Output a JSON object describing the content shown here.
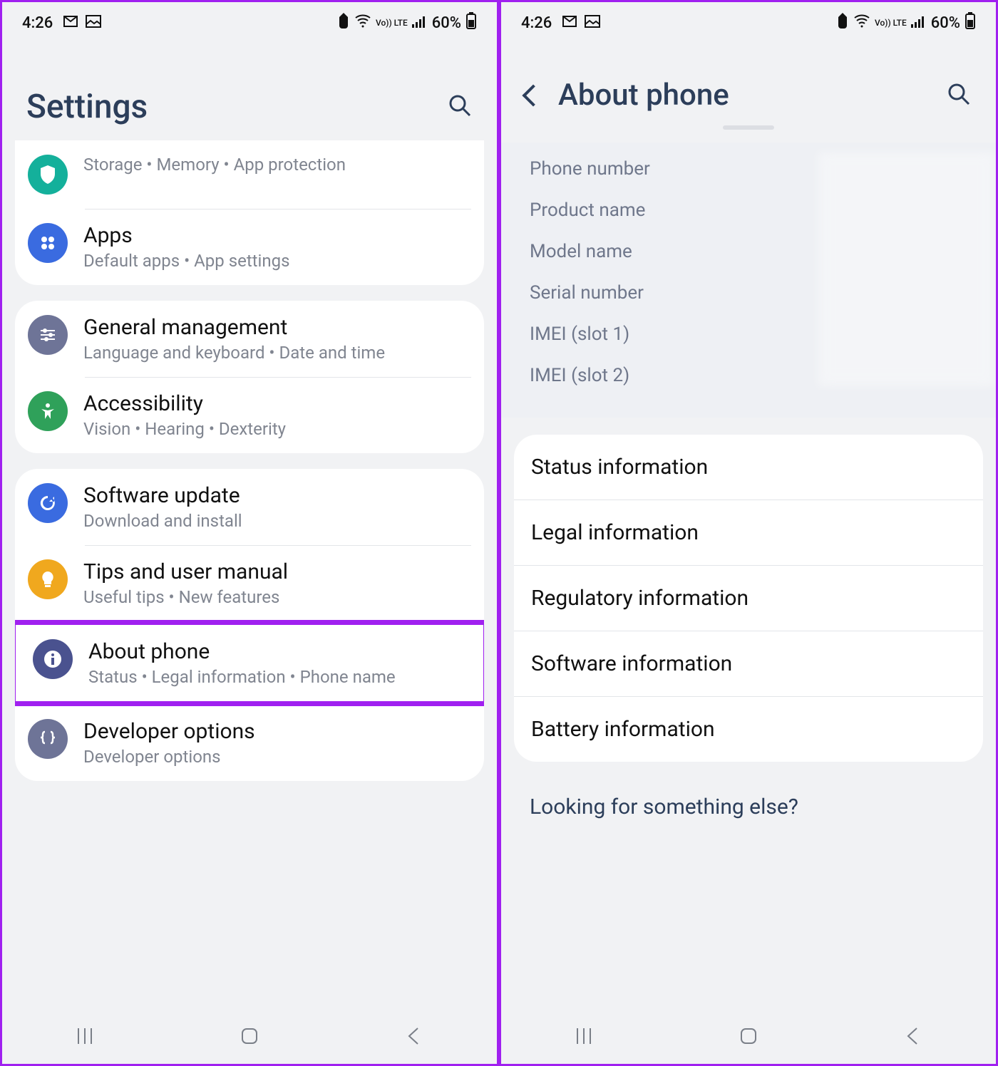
{
  "status": {
    "time": "4:26",
    "battery": "60%",
    "volte": "Vo)) LTE"
  },
  "left": {
    "title": "Settings",
    "partial_sub": "Storage  •  Memory  •  App protection",
    "items": [
      {
        "icon": "apps",
        "bg": "#3a6be0",
        "title": "Apps",
        "sub": "Default apps  •  App settings"
      }
    ],
    "group2": [
      {
        "icon": "general",
        "bg": "#6e7497",
        "title": "General management",
        "sub": "Language and keyboard  •  Date and time"
      },
      {
        "icon": "accessibility",
        "bg": "#2fa15a",
        "title": "Accessibility",
        "sub": "Vision  •  Hearing  •  Dexterity"
      }
    ],
    "group3": [
      {
        "icon": "update",
        "bg": "#3a6be0",
        "title": "Software update",
        "sub": "Download and install"
      },
      {
        "icon": "tips",
        "bg": "#f0a81e",
        "title": "Tips and user manual",
        "sub": "Useful tips  •  New features"
      },
      {
        "icon": "about",
        "bg": "#4a528f",
        "title": "About phone",
        "sub": "Status  •  Legal information  •  Phone name",
        "highlight": true
      },
      {
        "icon": "developer",
        "bg": "#6e7497",
        "title": "Developer options",
        "sub": "Developer options"
      }
    ]
  },
  "right": {
    "title": "About phone",
    "info": [
      "Phone number",
      "Product name",
      "Model name",
      "Serial number",
      "IMEI (slot 1)",
      "IMEI (slot 2)"
    ],
    "sections": [
      "Status information",
      "Legal information",
      "Regulatory information",
      "Software information",
      "Battery information"
    ],
    "suggest": "Looking for something else?"
  }
}
